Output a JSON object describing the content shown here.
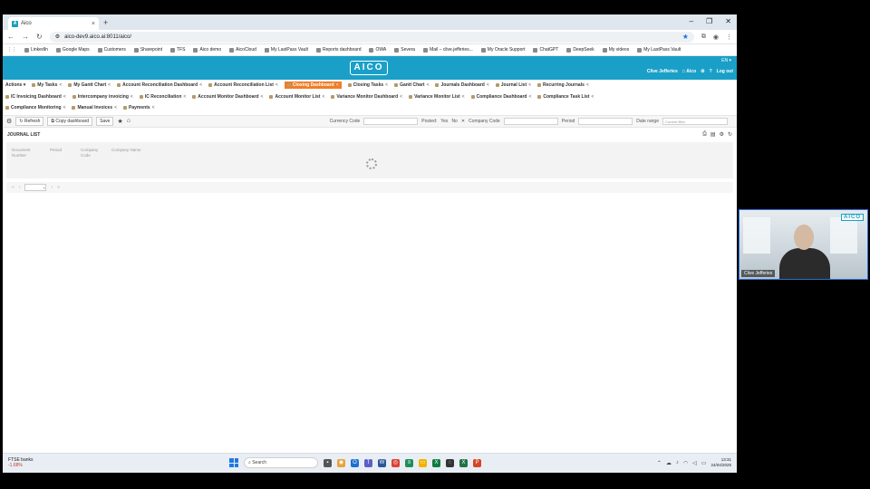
{
  "browser": {
    "tab_title": "Aico",
    "tab_icon": "A",
    "url": "aico-dev9.aico.ai:8011/aico/",
    "bookmarks": [
      "LinkedIn",
      "Google Maps",
      "Customers",
      "Sharepoint",
      "TFS",
      "Aico demo",
      "AicoCloud",
      "My LastPass Vault",
      "Reports dashboard",
      "OWA",
      "Severa",
      "Mail – clive.jefferies...",
      "My Oracle Support",
      "ChatGPT",
      "DeepSeek",
      "My videos",
      "My LastPass Vault"
    ]
  },
  "app": {
    "logo": "AICO",
    "lang": "EN ▾",
    "user": "Clive Jefferies",
    "company": ":: Aico",
    "logout": "Log out"
  },
  "menu_row1": [
    {
      "label": "Actions ▾",
      "active": false
    },
    {
      "label": "My Tasks",
      "active": false
    },
    {
      "label": "My Gantt Chart",
      "active": false
    },
    {
      "label": "Account Reconciliation Dashboard",
      "active": false
    },
    {
      "label": "Account Reconciliation List",
      "active": false
    },
    {
      "label": "Closing Dashboard",
      "active": true
    },
    {
      "label": "Closing Tasks",
      "active": false
    },
    {
      "label": "Gantt Chart",
      "active": false
    },
    {
      "label": "Journals Dashboard",
      "active": false
    },
    {
      "label": "Journal List",
      "active": false
    },
    {
      "label": "Recurring Journals",
      "active": false
    }
  ],
  "menu_row2": [
    {
      "label": "IC Invoicing Dashboard"
    },
    {
      "label": "Intercompany invoicing"
    },
    {
      "label": "IC Reconciliation"
    },
    {
      "label": "Account Monitor Dashboard"
    },
    {
      "label": "Account Monitor List"
    },
    {
      "label": "Variance Monitor Dashboard"
    },
    {
      "label": "Variance Monitor List"
    },
    {
      "label": "Compliance Dashboard"
    },
    {
      "label": "Compliance Task List"
    }
  ],
  "menu_row3": [
    {
      "label": "Compliance Monitoring"
    },
    {
      "label": "Manual Invoices"
    },
    {
      "label": "Payments"
    }
  ],
  "toolbar": {
    "refresh": "Refresh",
    "copy_dashboard": "Copy dashboard",
    "save": "Save",
    "currency_code_label": "Currency Code",
    "posted_label": "Posted:",
    "posted_yes": "Yes",
    "posted_no": "No",
    "company_code_label": "Company Code",
    "period_label": "Period",
    "date_range_label": "Date range",
    "date_range_value": "Current filter"
  },
  "journal_list": {
    "title": "JOURNAL LIST",
    "columns": [
      "Document Number",
      "Period",
      "Company Code",
      "Company Name"
    ]
  },
  "taskbar": {
    "ftse_title": "FTSE banks",
    "ftse_change": "-1.68%",
    "search": "Search",
    "time": "13:31",
    "date": "24/04/2025"
  },
  "webcam": {
    "name": "Clive Jefferies",
    "logo": "AICO"
  }
}
